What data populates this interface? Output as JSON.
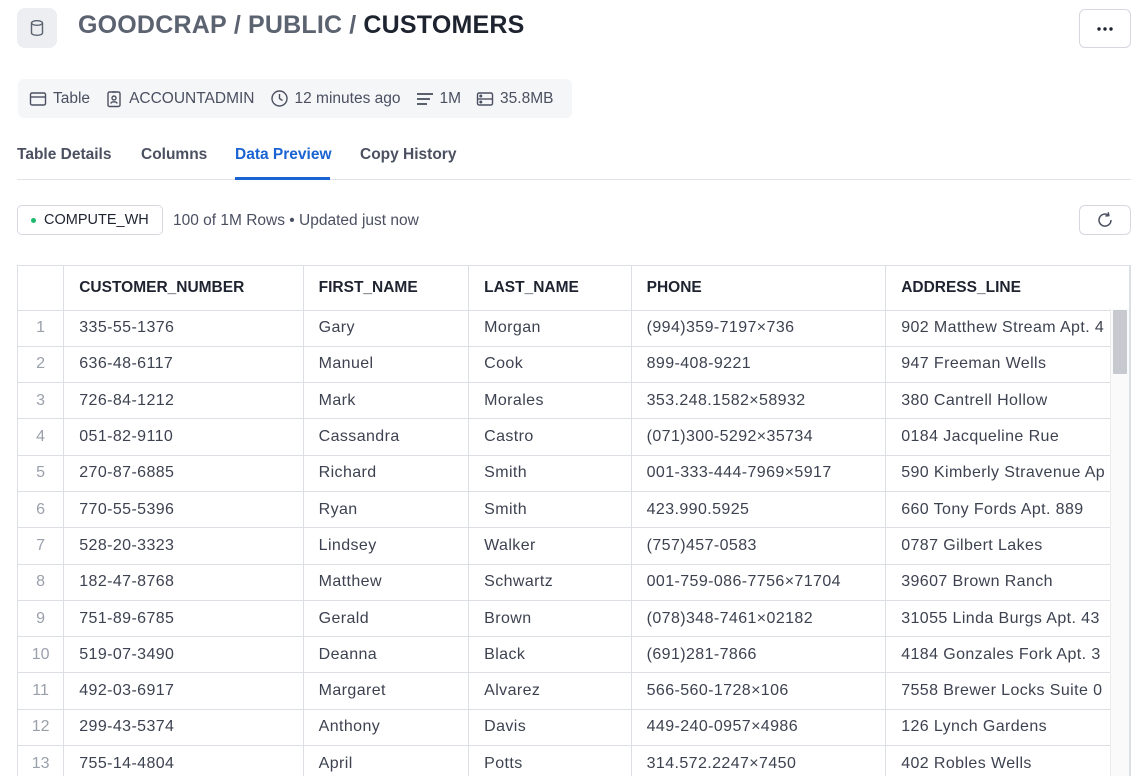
{
  "header": {
    "database": "GOODCRAP",
    "schema": "PUBLIC",
    "table": "CUSTOMERS",
    "separator": "/",
    "more_label": "···"
  },
  "meta": {
    "type": "Table",
    "owner": "ACCOUNTADMIN",
    "modified": "12 minutes ago",
    "rows": "1M",
    "size": "35.8MB"
  },
  "tabs": [
    {
      "label": "Table Details",
      "active": false
    },
    {
      "label": "Columns",
      "active": false
    },
    {
      "label": "Data Preview",
      "active": true
    },
    {
      "label": "Copy History",
      "active": false
    }
  ],
  "warehouse": {
    "name": "COMPUTE_WH",
    "status_color": "#1fb86f",
    "rows_info": "100 of 1M Rows • Updated just now"
  },
  "grid": {
    "columns": [
      "CUSTOMER_NUMBER",
      "FIRST_NAME",
      "LAST_NAME",
      "PHONE",
      "ADDRESS_LINE"
    ],
    "rows": [
      [
        "1",
        "335-55-1376",
        "Gary",
        "Morgan",
        "(994)359-7197×736",
        "902 Matthew Stream Apt. 4"
      ],
      [
        "2",
        "636-48-6117",
        "Manuel",
        "Cook",
        "899-408-9221",
        "947 Freeman Wells"
      ],
      [
        "3",
        "726-84-1212",
        "Mark",
        "Morales",
        "353.248.1582×58932",
        "380 Cantrell Hollow"
      ],
      [
        "4",
        "051-82-9110",
        "Cassandra",
        "Castro",
        "(071)300-5292×35734",
        "0184 Jacqueline Rue"
      ],
      [
        "5",
        "270-87-6885",
        "Richard",
        "Smith",
        "001-333-444-7969×5917",
        "590 Kimberly Stravenue Ap"
      ],
      [
        "6",
        "770-55-5396",
        "Ryan",
        "Smith",
        "423.990.5925",
        "660 Tony Fords Apt. 889"
      ],
      [
        "7",
        "528-20-3323",
        "Lindsey",
        "Walker",
        "(757)457-0583",
        "0787 Gilbert Lakes"
      ],
      [
        "8",
        "182-47-8768",
        "Matthew",
        "Schwartz",
        "001-759-086-7756×71704",
        "39607 Brown Ranch"
      ],
      [
        "9",
        "751-89-6785",
        "Gerald",
        "Brown",
        "(078)348-7461×02182",
        "31055 Linda Burgs Apt. 43"
      ],
      [
        "10",
        "519-07-3490",
        "Deanna",
        "Black",
        "(691)281-7866",
        "4184 Gonzales Fork Apt. 3"
      ],
      [
        "11",
        "492-03-6917",
        "Margaret",
        "Alvarez",
        "566-560-1728×106",
        "7558 Brewer Locks Suite 0"
      ],
      [
        "12",
        "299-43-5374",
        "Anthony",
        "Davis",
        "449-240-0957×4986",
        "126 Lynch Gardens"
      ],
      [
        "13",
        "755-14-4804",
        "April",
        "Potts",
        "314.572.2247×7450",
        "402 Robles Wells"
      ]
    ]
  }
}
